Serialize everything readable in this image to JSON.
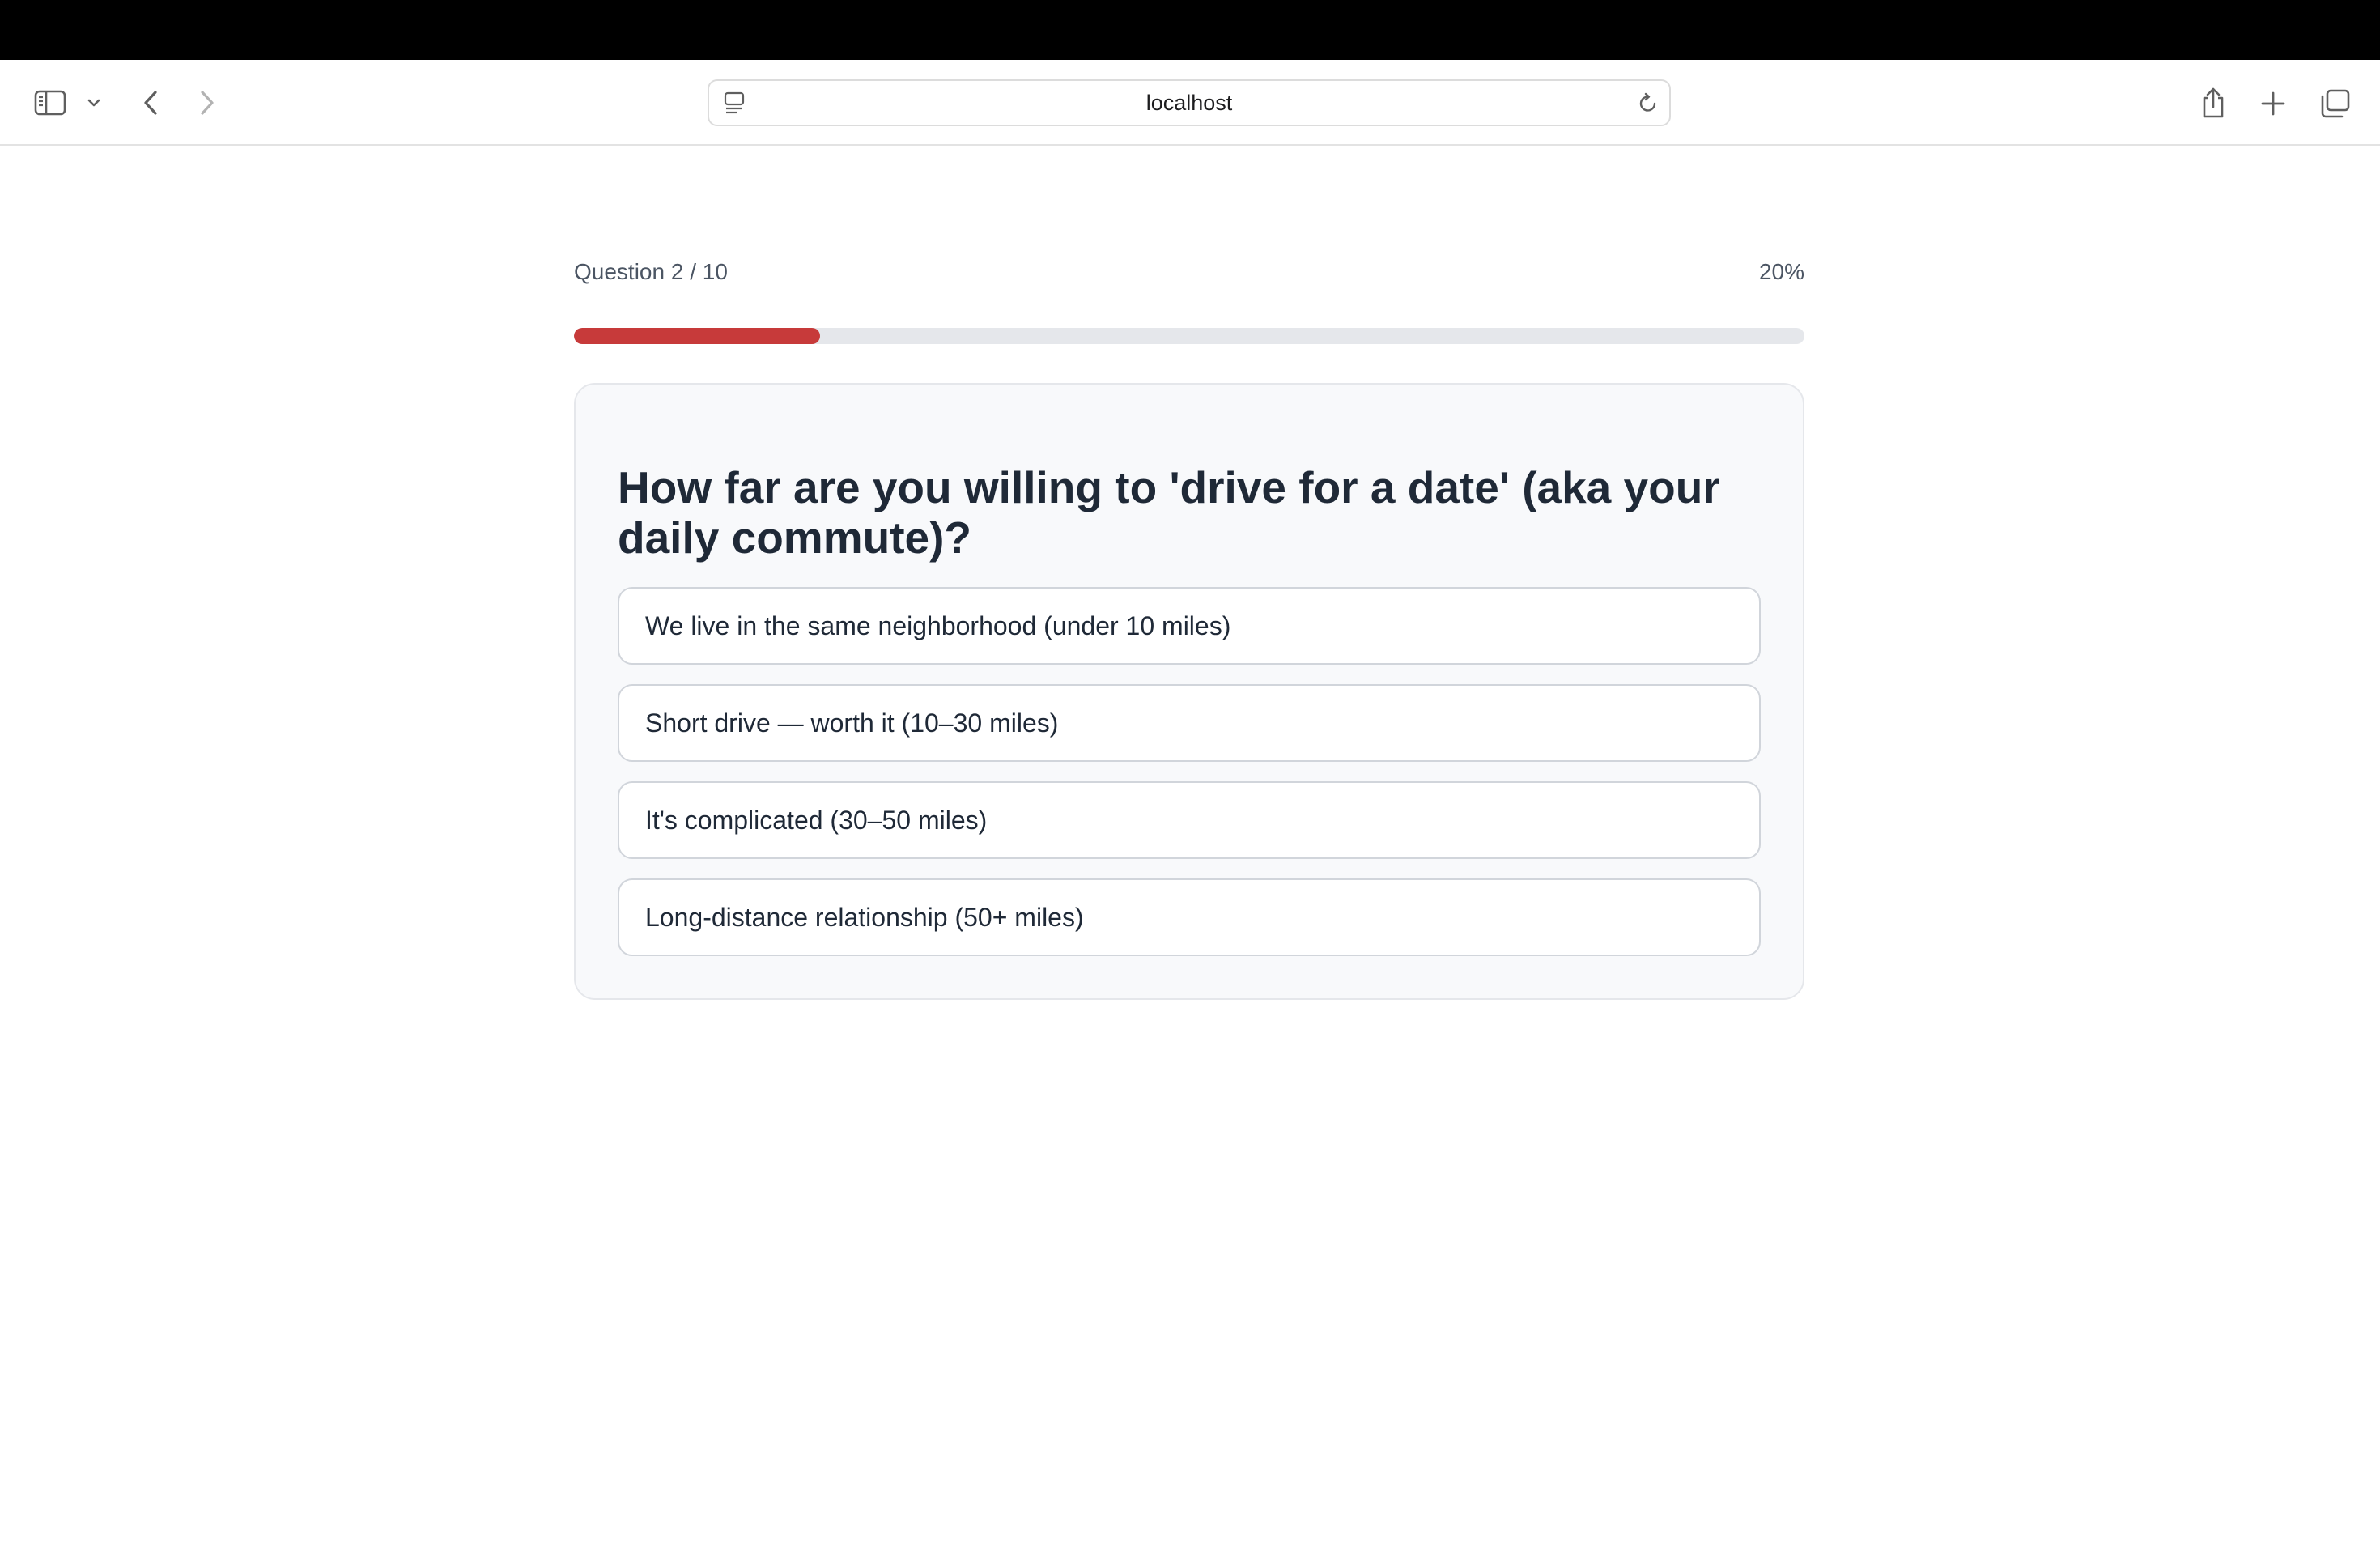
{
  "browser": {
    "address": "localhost"
  },
  "quiz": {
    "progress_label": "Question 2 / 10",
    "progress_percent_label": "20%",
    "progress_fraction": 0.2,
    "progress_color": "#c73a3a",
    "question": "How far are you willing to 'drive for a date' (aka your daily commute)?",
    "options": [
      "We live in the same neighborhood (under 10 miles)",
      "Short drive — worth it (10–30 miles)",
      "It's complicated (30–50 miles)",
      "Long-distance relationship (50+ miles)"
    ]
  },
  "icons": {
    "sidebar": "sidebar-icon",
    "sidebar_menu": "chevron-down-icon",
    "back": "chevron-left-icon",
    "forward": "chevron-right-icon",
    "page": "page-menu-icon",
    "reload": "reload-icon",
    "share": "share-icon",
    "new_tab": "plus-icon",
    "tabs": "tab-overview-icon"
  }
}
